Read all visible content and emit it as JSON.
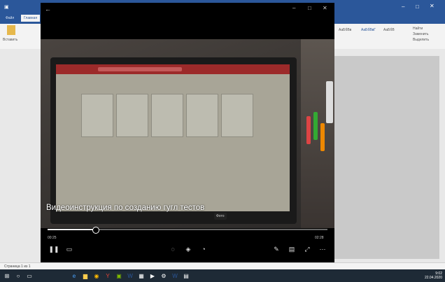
{
  "word": {
    "tabs": [
      "Файл",
      "Главная"
    ],
    "ribbon_left": "Вставить",
    "ribbon_styles": [
      "АаБбВв",
      "АаБбВвГ",
      "АаБбВ"
    ],
    "ribbon_right": [
      "Найти",
      "Заменить",
      "Выделить"
    ],
    "status": "Страница 1 из 1"
  },
  "player": {
    "subtitle": "Видеоинструкция по созданию гугл тестов",
    "tooltip": "Фото",
    "progress": 0.17,
    "time_current": "00:25",
    "time_total": "02:28"
  },
  "taskbar": {
    "clock_time": "9:02",
    "clock_date": "22.04.2020"
  }
}
